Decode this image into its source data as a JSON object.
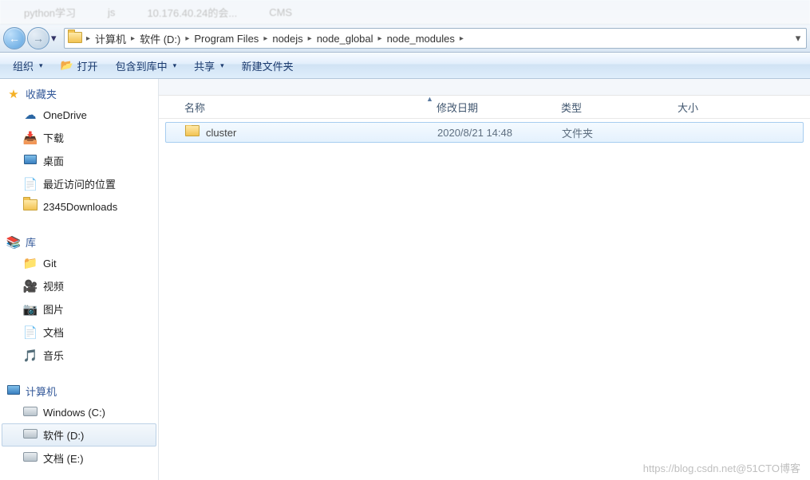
{
  "tabs_hint": [
    "python学习",
    "js",
    "10.176.40.24的会...",
    "CMS"
  ],
  "breadcrumbs": [
    "计算机",
    "软件 (D:)",
    "Program Files",
    "nodejs",
    "node_global",
    "node_modules"
  ],
  "toolbar": {
    "organize": "组织",
    "open": "打开",
    "include": "包含到库中",
    "share": "共享",
    "newfolder": "新建文件夹"
  },
  "sidebar": {
    "favorites": {
      "label": "收藏夹",
      "items": [
        "OneDrive",
        "下载",
        "桌面",
        "最近访问的位置",
        "2345Downloads"
      ]
    },
    "libraries": {
      "label": "库",
      "items": [
        "Git",
        "视频",
        "图片",
        "文档",
        "音乐"
      ]
    },
    "computer": {
      "label": "计算机",
      "items": [
        "Windows (C:)",
        "软件 (D:)",
        "文档 (E:)"
      ],
      "selected": 1
    }
  },
  "columns": {
    "name": "名称",
    "date": "修改日期",
    "type": "类型",
    "size": "大小"
  },
  "files": [
    {
      "name": "cluster",
      "date": "2020/8/21 14:48",
      "type": "文件夹",
      "size": ""
    }
  ],
  "watermark": "https://blog.csdn.net@51CTO博客"
}
